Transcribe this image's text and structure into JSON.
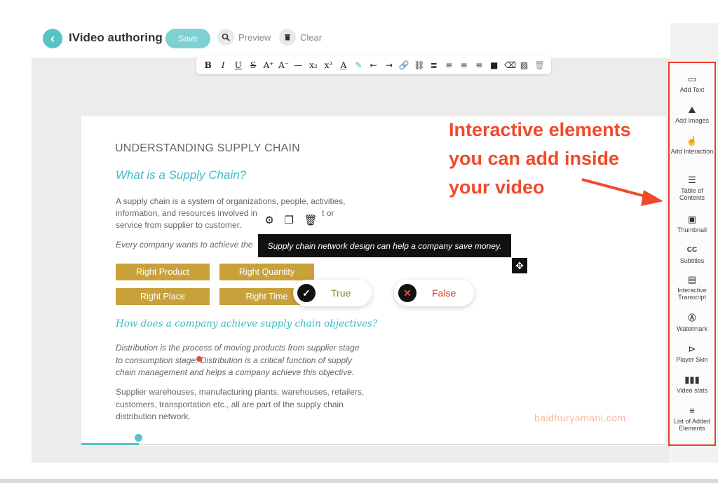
{
  "header": {
    "back_icon": "chevron-left-icon",
    "title": "IVideo authoring",
    "save_label": "Save",
    "preview_label": "Preview",
    "clear_label": "Clear"
  },
  "toolbar": {
    "buttons": [
      "B",
      "I",
      "U",
      "S",
      "A⁺",
      "A⁻",
      "—",
      "x₂",
      "x²",
      "A",
      "✎",
      "⇤",
      "⇥",
      "🔗",
      "⛓",
      "≣",
      "≡",
      "≡",
      "≡",
      "■",
      "⌫",
      "▨",
      "🗑"
    ]
  },
  "slide": {
    "title": "UNDERSTANDING SUPPLY CHAIN",
    "subtitle": "What is a Supply Chain?",
    "para1": "A supply chain is a system of organizations, people, activities, information, and resources involved in moving a product or service from supplier to customer.",
    "quote": "Every company wants to achieve the",
    "chips": [
      "Right Product",
      "Right Quantity",
      "Right Place",
      "Right Time"
    ],
    "heading2": "How does a company achieve supply chain objectives?",
    "dist": "Distribution is the process of moving products from supplier stage to consumption stage. Distribution is a critical function of supply chain management and  helps a company achieve this objective.",
    "warehouses": "Supplier warehouses, manufacturing plants, warehouses, retailers, customers, transportation  etc., all are part of the supply chain distribution network.",
    "watermark": "baidhuryamani.com"
  },
  "interaction": {
    "question": "Supply chain network design can help a company save money.",
    "true_label": "True",
    "false_label": "False",
    "colors": {
      "true": "#6a8f2a",
      "false": "#d23a2a"
    }
  },
  "annotation": {
    "line1": "Interactive elements",
    "line2": "you can add inside",
    "line3": "your video"
  },
  "sidebar": {
    "items": [
      {
        "label": "Add Text",
        "icon": "text-box-icon"
      },
      {
        "label": "Add Images",
        "icon": "image-icon"
      },
      {
        "label": "Add Interaction",
        "icon": "pointer-icon"
      },
      {
        "label": "Table of Contents",
        "icon": "list-icon"
      },
      {
        "label": "Thumbnail",
        "icon": "picture-icon"
      },
      {
        "label": "Subtitles",
        "icon": "cc-icon"
      },
      {
        "label": "Interactive Transcript",
        "icon": "transcript-icon"
      },
      {
        "label": "Watermark",
        "icon": "watermark-icon"
      },
      {
        "label": "Player Skin",
        "icon": "play-icon"
      },
      {
        "label": "Video stats",
        "icon": "bar-chart-icon"
      },
      {
        "label": "List of Added Elements",
        "icon": "menu-icon"
      }
    ]
  },
  "colors": {
    "accent": "#55c4c6",
    "chip": "#c9a13a",
    "annotation": "#f04a2a"
  }
}
